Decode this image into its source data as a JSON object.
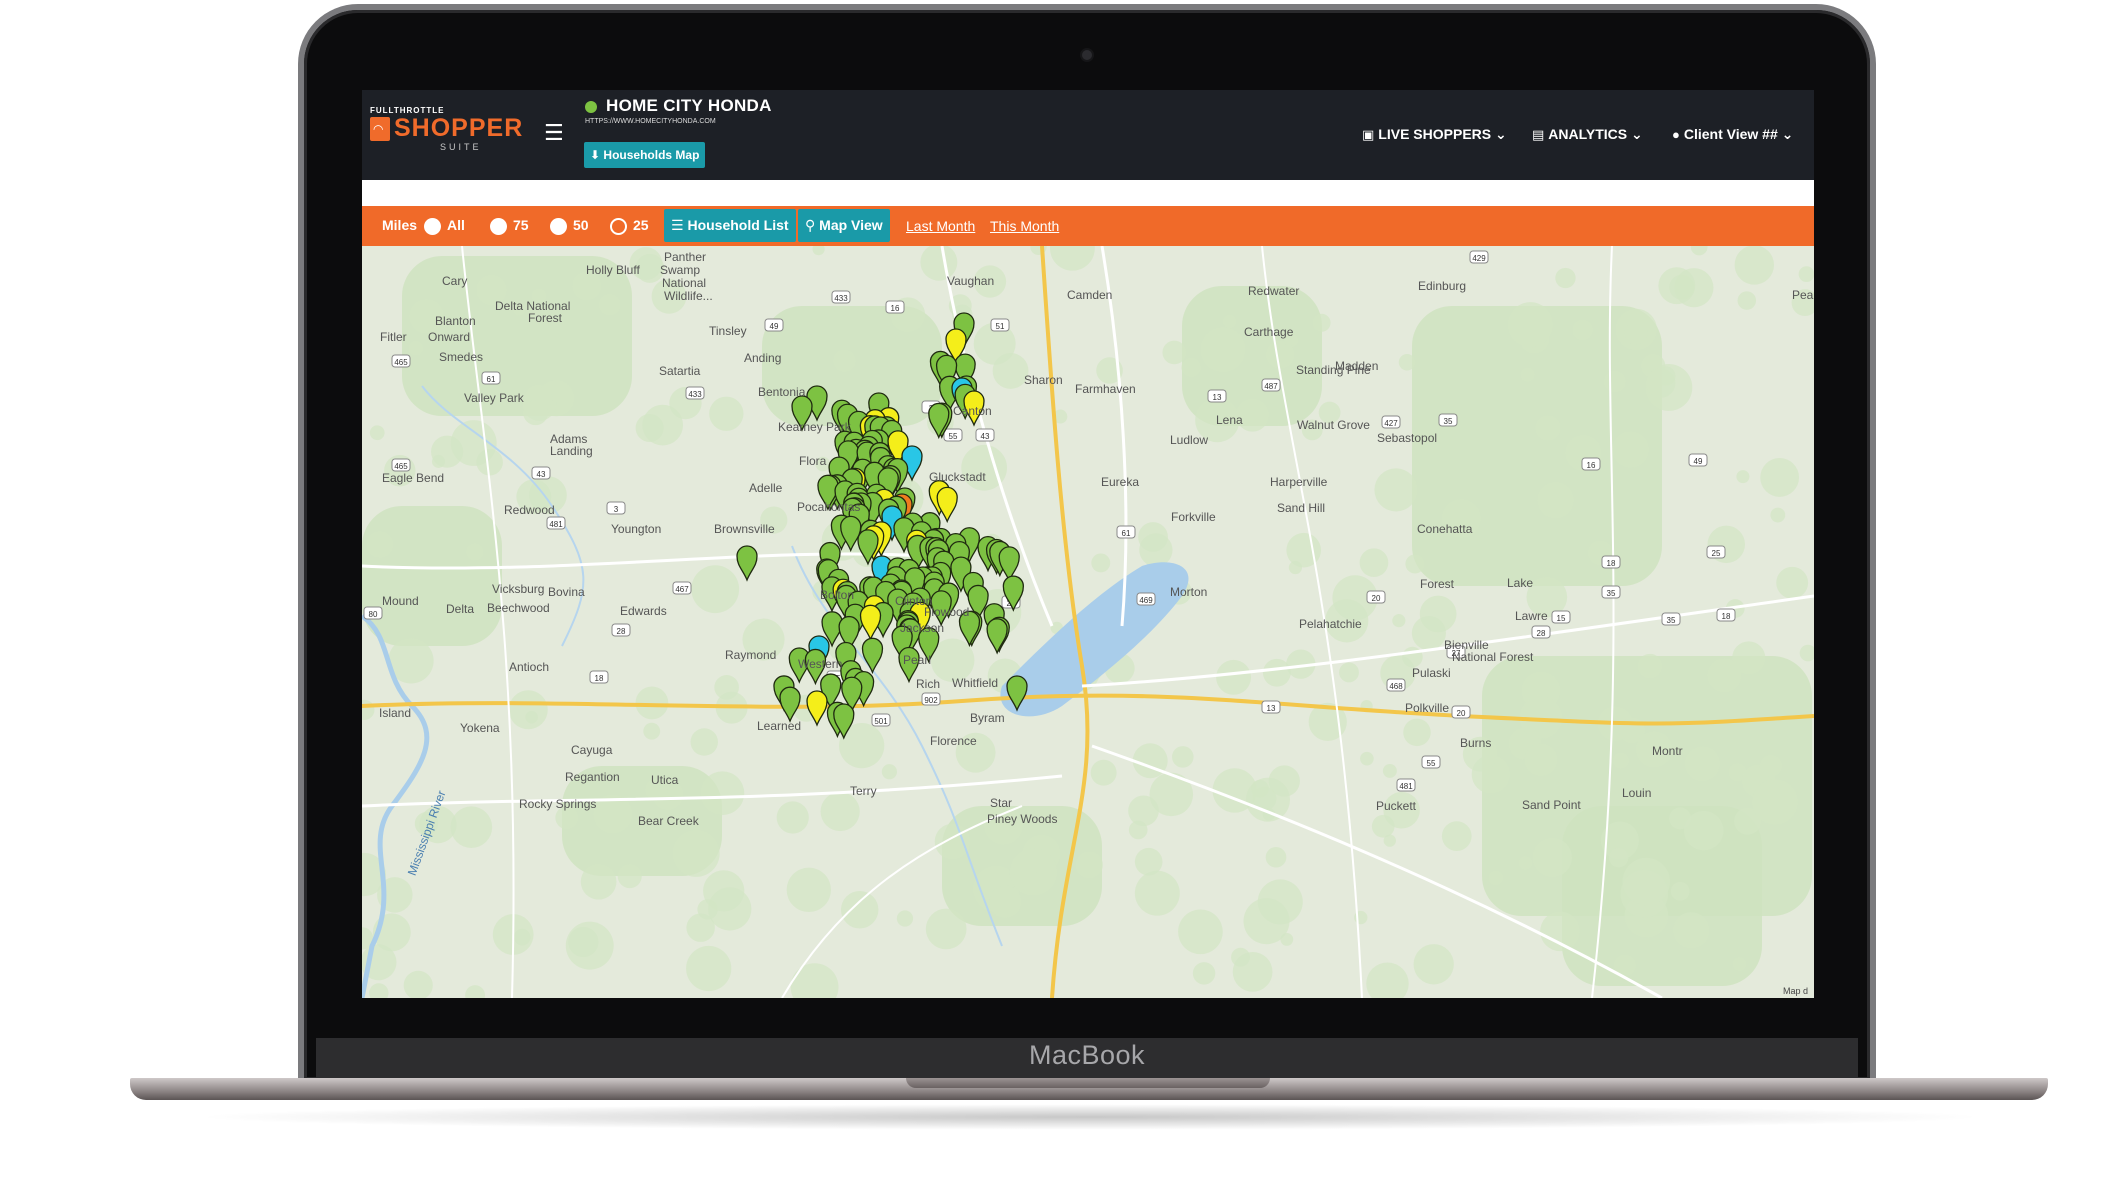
{
  "device": {
    "brand_label": "MacBook"
  },
  "header": {
    "logo": {
      "top_text": "FULLTHROTTLE",
      "main_text": "SHOPPER",
      "sub_text": "SUITE"
    },
    "dealer_name": "HOME CITY HONDA",
    "dealer_url": "HTTPS://WWW.HOMECITYHONDA.COM",
    "status_color": "#7dc242",
    "households_map_button": "Households Map",
    "nav": [
      {
        "label": "LIVE SHOPPERS",
        "icon": "id-card-icon"
      },
      {
        "label": "ANALYTICS",
        "icon": "bar-chart-icon"
      },
      {
        "label": "Client View ##",
        "icon": "user-circle-icon"
      }
    ]
  },
  "filter_bar": {
    "miles_label": "Miles",
    "options": [
      {
        "label": "All",
        "selected": false
      },
      {
        "label": "75",
        "selected": false
      },
      {
        "label": "50",
        "selected": false
      },
      {
        "label": "25",
        "selected": true
      }
    ],
    "household_list_label": "Household List",
    "map_view_label": "Map View",
    "last_month_label": "Last Month",
    "this_month_label": "This Month"
  },
  "colors": {
    "accent_orange": "#f06a29",
    "button_teal": "#1a9aa8",
    "header_dark": "#1d2026",
    "marker_green": "#7dc242",
    "marker_yellow": "#f4ee1a",
    "marker_cyan": "#29c6e6",
    "marker_orange": "#f07d1e"
  },
  "map": {
    "attribution": "Map d",
    "places": [
      "Holly Bluff",
      "Cary",
      "Panther",
      "Swamp",
      "National",
      "Wildlife...",
      "Vaughan",
      "Delta National",
      "Forest",
      "Blanton",
      "Fitler",
      "Onward",
      "Tinsley",
      "Camden",
      "Redwater",
      "Edinburg",
      "Pearl",
      "Carthage",
      "Smedes",
      "Anding",
      "Satartia",
      "Sharon",
      "Standing Pine",
      "Madden",
      "Valley Park",
      "Farmhaven",
      "Bentonia",
      "Kearney Park",
      "Canton",
      "Lena",
      "Walnut Grove",
      "Sebastopol",
      "Ludlow",
      "Adams",
      "Landing",
      "Flora",
      "Gluckstadt",
      "Eagle Bend",
      "Eureka",
      "Harperville",
      "Adelle",
      "Sand Hill",
      "Redwood",
      "Pocahontas",
      "Forkville",
      "Conehatta",
      "Youngton",
      "Brownsville",
      "Vicksburg",
      "Bovina",
      "Bolton",
      "Clinton",
      "Morton",
      "Forest",
      "Flowood",
      "Mound",
      "Delta",
      "Beechwood",
      "Edwards",
      "Jackson",
      "Pelahatchie",
      "Lake",
      "Lawre",
      "Raymond",
      "Pearl",
      "Pulaski",
      "Bienville",
      "National Forest",
      "Western",
      "Antioch",
      "Rich",
      "Whitfield",
      "Island",
      "Learned",
      "Byram",
      "Polkville",
      "Yokena",
      "Cayuga",
      "Florence",
      "Burns",
      "Regantion",
      "Montr",
      "Utica",
      "Rocky Springs",
      "Terry",
      "Star",
      "Puckett",
      "Sand Point",
      "Bear Creek",
      "Piney Woods",
      "Louin",
      "Mississippi River"
    ],
    "highways": [
      "433",
      "16",
      "429",
      "49",
      "51",
      "465",
      "61",
      "433",
      "3",
      "55",
      "43",
      "13",
      "487",
      "35",
      "427",
      "16",
      "3",
      "465",
      "43",
      "481",
      "61",
      "20",
      "20",
      "467",
      "18",
      "80",
      "35",
      "20",
      "25",
      "49",
      "469",
      "468",
      "55",
      "501",
      "902",
      "13",
      "481",
      "27",
      "28",
      "18",
      "28",
      "55",
      "15",
      "18",
      "35"
    ],
    "marker_counts": {
      "green": 140,
      "yellow": 16,
      "cyan": 5,
      "orange": 1
    }
  }
}
